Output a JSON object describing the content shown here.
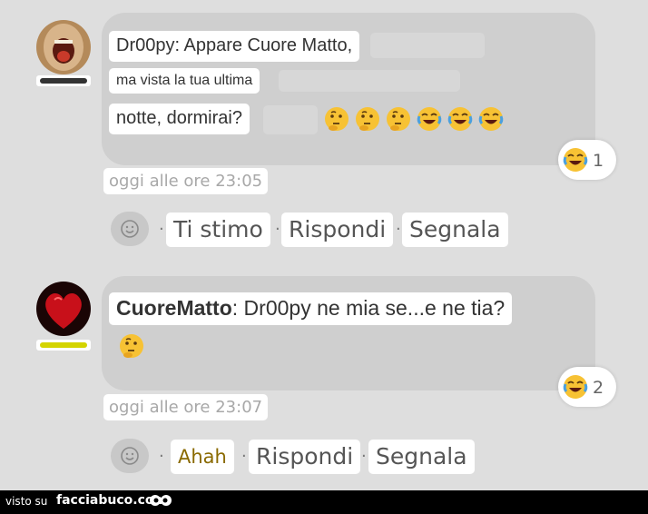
{
  "comments": [
    {
      "text_lines": [
        "Dr00py: Appare Cuore Matto,",
        "ma vista la tua ultima",
        "notte, dormirai?"
      ],
      "emojis": [
        "thinking-emoji",
        "thinking-emoji",
        "thinking-emoji",
        "joy-emoji",
        "joy-emoji",
        "joy-emoji"
      ],
      "reaction_count": "1",
      "timestamp": "oggi alle ore 23:05",
      "actions": {
        "first": "Ti stimo",
        "reply": "Rispondi",
        "report": "Segnala"
      },
      "rank_color": "#333333"
    },
    {
      "author": "CuoreMatto",
      "text": ": Dr00py ne mia se...e ne tia?",
      "emojis": [
        "thinking-emoji"
      ],
      "reaction_count": "2",
      "timestamp": "oggi alle ore 23:07",
      "actions": {
        "first": "Ahah",
        "reply": "Rispondi",
        "report": "Segnala"
      },
      "rank_color": "#d4d400"
    }
  ],
  "footer": {
    "visto_su": "visto su",
    "brand": "facciabuco.com"
  }
}
